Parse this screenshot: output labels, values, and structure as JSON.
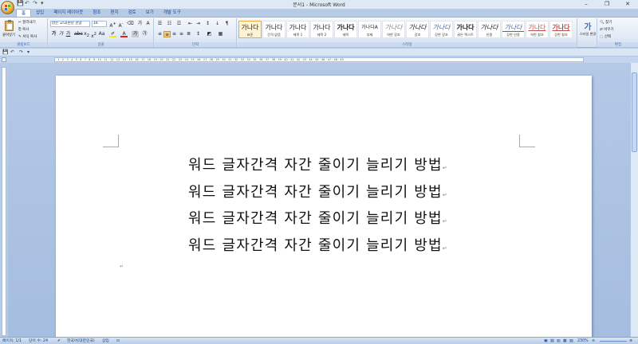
{
  "window": {
    "title": "문서1 - Microsoft Word",
    "controls": [
      "–",
      "❐",
      "✕"
    ]
  },
  "qat": [
    "💾",
    "↶",
    "↷",
    "▾"
  ],
  "tabs": [
    {
      "label": "홈",
      "active": true
    },
    {
      "label": "삽입"
    },
    {
      "label": "페이지 레이아웃"
    },
    {
      "label": "참조"
    },
    {
      "label": "편지"
    },
    {
      "label": "검토"
    },
    {
      "label": "보기"
    },
    {
      "label": "개발 도구"
    }
  ],
  "clipboard": {
    "paste_label": "붙여넣기",
    "cut_label": "잘라내기",
    "copy_label": "복사",
    "format_painter_label": "서식 복사",
    "group_label": "클립보드"
  },
  "font": {
    "font_name": "맑은 고딕(본문 한글",
    "font_size": "16",
    "group_label": "글꼴"
  },
  "paragraph": {
    "group_label": "단락"
  },
  "styles": {
    "group_label": "스타일",
    "items": [
      {
        "sample": "가나다",
        "name": "표준",
        "selected": true
      },
      {
        "sample": "가나다",
        "name": "간격 없음"
      },
      {
        "sample": "가나다",
        "name": "제목 1"
      },
      {
        "sample": "가나다",
        "name": "제목 2"
      },
      {
        "sample": "가나다",
        "name": "제목"
      },
      {
        "sample": "가나다A",
        "name": "부제"
      },
      {
        "sample": "가나다",
        "name": "약한 강조"
      },
      {
        "sample": "가나다",
        "name": "강조"
      },
      {
        "sample": "가나다",
        "name": "강한 강조"
      },
      {
        "sample": "가나다",
        "name": "굵은 텍스트"
      },
      {
        "sample": "가나다",
        "name": "인용"
      },
      {
        "sample": "가나다",
        "name": "강한 인용"
      },
      {
        "sample": "가나다",
        "name": "약한 참조"
      },
      {
        "sample": "가나다",
        "name": "강한 참조"
      }
    ],
    "change_styles_label": "스타일 변경"
  },
  "editing": {
    "find_label": "찾기",
    "replace_label": "바꾸기",
    "select_label": "선택",
    "group_label": "편집"
  },
  "document": {
    "lines": [
      "워드 글자간격 자간 줄이기 늘리기 방법",
      "워드 글자간격 자간 줄이기 늘리기 방법",
      "워드 글자간격 자간 줄이기 늘리기 방법",
      "워드 글자간격 자간 줄이기 늘리기 방법"
    ]
  },
  "status": {
    "page": "페이지: 1/1",
    "words": "단어 수: 24",
    "language": "한국어(대한민국)",
    "mode": "삽입",
    "zoom": "230%"
  }
}
